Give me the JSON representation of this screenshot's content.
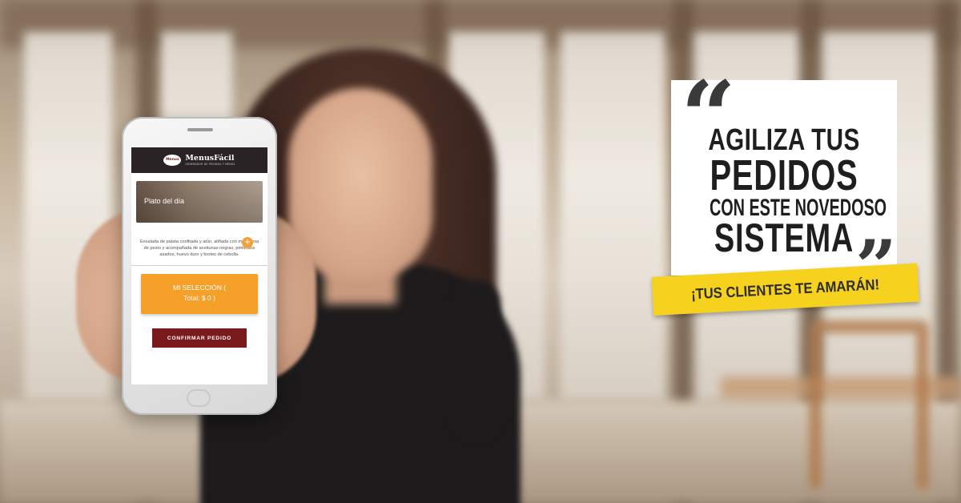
{
  "app": {
    "brand_name": "MenusFácil",
    "brand_tagline": "GENERADOR DE PEDIDOS Y MENUS",
    "logo_badge_text": "Menus",
    "dish_card": {
      "title": "Plato del día",
      "add_label": "+",
      "description": "Ensalada de patata confitada y atún, aliñada con mayonesa de pesto y acompañada de aceitunas negras, pimientos asados, huevo duro y brotes de cebolla."
    },
    "selection_button": {
      "line1": "MI SELECCIÓN (",
      "line2": "Total: $ 0 )"
    },
    "confirm_button": "CONFIRMAR PEDIDO",
    "colors": {
      "header": "#2a2326",
      "accent_orange": "#f4a029",
      "confirm_red": "#7b1a1d"
    }
  },
  "ad": {
    "quote_open": "“",
    "quote_close": "”",
    "headline_line1": "AGILIZA TUS",
    "headline_line2": "PEDIDOS",
    "headline_line3": "CON ESTE NOVEDOSO",
    "headline_line4": "SISTEMA",
    "banner": "¡TUS CLIENTES TE AMARÁN!",
    "colors": {
      "banner": "#f6d21f",
      "card": "#ffffff"
    }
  }
}
